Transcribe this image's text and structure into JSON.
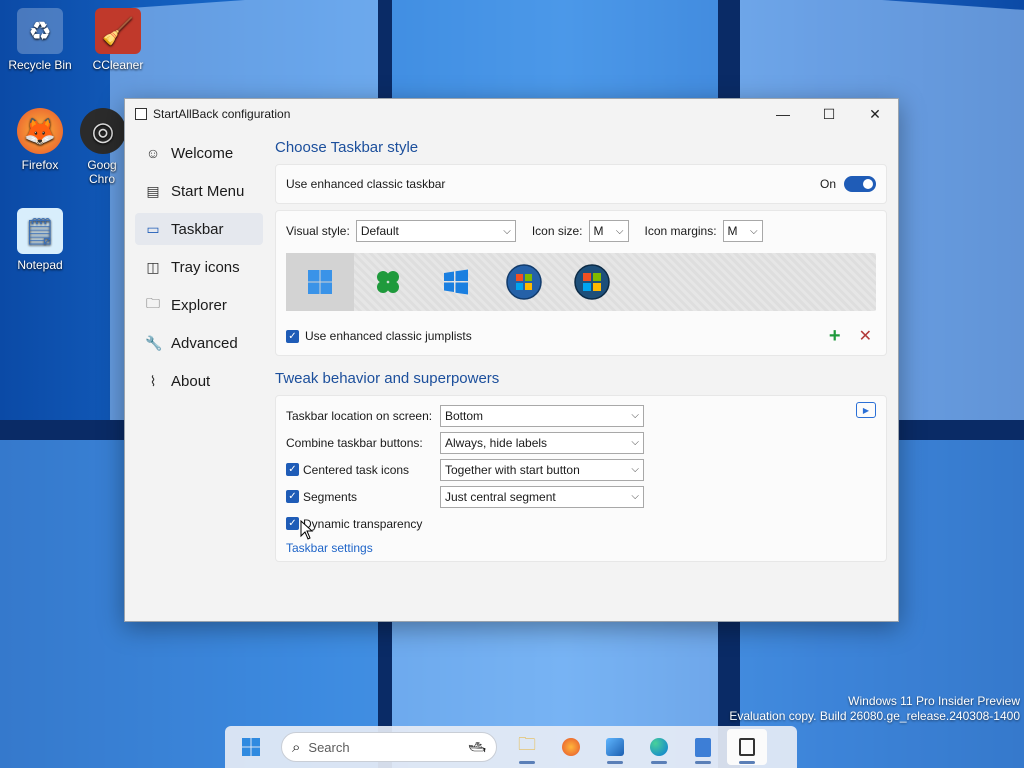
{
  "desktop": {
    "icons": [
      {
        "label": "Recycle Bin",
        "icon": "recycle-bin-icon"
      },
      {
        "label": "CCleaner",
        "icon": "ccleaner-icon"
      },
      {
        "label": "Firefox",
        "icon": "firefox-icon"
      },
      {
        "label": "Goog Chro",
        "icon": "chrome-icon"
      },
      {
        "label": "Notepad",
        "icon": "notepad-icon"
      }
    ],
    "watermark_line1": "Windows 11 Pro Insider Preview",
    "watermark_line2": "Evaluation copy. Build 26080.ge_release.240308-1400"
  },
  "taskbar": {
    "search_placeholder": "Search",
    "apps": [
      "start-icon",
      "file-explorer-icon",
      "firefox-icon",
      "photos-icon",
      "edge-icon",
      "notepad-icon",
      "startallback-icon"
    ]
  },
  "window": {
    "title": "StartAllBack configuration",
    "buttons": {
      "minimize": "—",
      "maximize": "☐",
      "close": "✕"
    }
  },
  "sidebar": {
    "items": [
      {
        "label": "Welcome",
        "icon": "smile-icon",
        "glyph": "☺"
      },
      {
        "label": "Start Menu",
        "icon": "start-menu-icon",
        "glyph": "▤"
      },
      {
        "label": "Taskbar",
        "icon": "taskbar-icon",
        "glyph": "▭"
      },
      {
        "label": "Tray icons",
        "icon": "tray-icon",
        "glyph": "◫"
      },
      {
        "label": "Explorer",
        "icon": "folder-icon",
        "glyph": "🗀"
      },
      {
        "label": "Advanced",
        "icon": "wrench-icon",
        "glyph": "🔧"
      },
      {
        "label": "About",
        "icon": "about-icon",
        "glyph": "⌇"
      }
    ],
    "selected": "Taskbar"
  },
  "main": {
    "section1_title": "Choose Taskbar style",
    "enhanced_label": "Use enhanced classic taskbar",
    "enhanced_state": "On",
    "visual_style_label": "Visual style:",
    "visual_style_value": "Default",
    "icon_size_label": "Icon size:",
    "icon_size_value": "M",
    "icon_margins_label": "Icon margins:",
    "icon_margins_value": "M",
    "style_tiles": [
      "windows11-style-icon",
      "clover-style-icon",
      "windows10-style-icon",
      "windows7-orb-icon",
      "windows-vista-orb-icon"
    ],
    "jumplists_label": "Use enhanced classic jumplists",
    "add_glyph": "+",
    "remove_glyph": "✕",
    "section2_title": "Tweak behavior and superpowers",
    "location_label": "Taskbar location on screen:",
    "location_value": "Bottom",
    "combine_label": "Combine taskbar buttons:",
    "combine_value": "Always, hide labels",
    "centered_label": "Centered task icons",
    "centered_value": "Together with start button",
    "segments_label": "Segments",
    "segments_value": "Just central segment",
    "dynamic_label": "Dynamic transparency",
    "settings_link": "Taskbar settings"
  }
}
